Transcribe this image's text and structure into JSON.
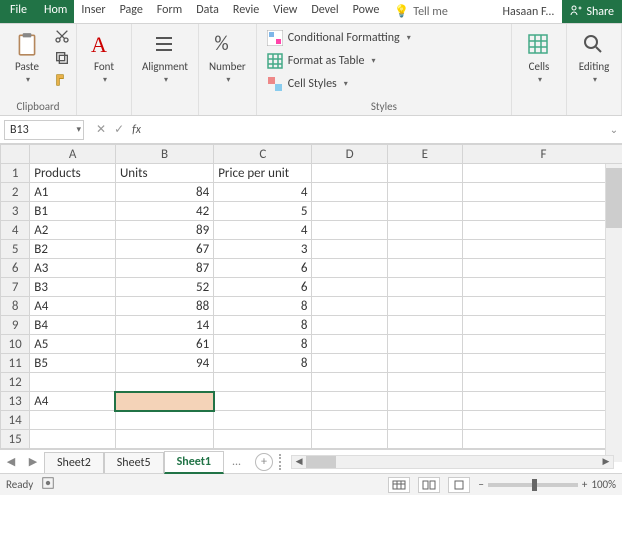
{
  "tabs": {
    "file": "File",
    "items": [
      "Hom",
      "Inser",
      "Page",
      "Form",
      "Data",
      "Revie",
      "View",
      "Devel",
      "Powe"
    ],
    "active_index": 0,
    "tellme": "Tell me",
    "user": "Hasaan F...",
    "share": "Share"
  },
  "ribbon": {
    "clipboard": {
      "label": "Clipboard",
      "paste": "Paste"
    },
    "font": {
      "label": "Font"
    },
    "alignment": {
      "label": "Alignment"
    },
    "number": {
      "label": "Number"
    },
    "styles": {
      "label": "Styles",
      "conditional": "Conditional Formatting",
      "table": "Format as Table",
      "cellstyles": "Cell Styles"
    },
    "cells": {
      "label": "Cells"
    },
    "editing": {
      "label": "Editing"
    }
  },
  "formula_bar": {
    "cellref": "B13",
    "formula": ""
  },
  "grid": {
    "columns": [
      "A",
      "B",
      "C",
      "D",
      "E",
      "F"
    ],
    "headers": {
      "A": "Products",
      "B": "Units",
      "C": "Price per unit"
    },
    "rows": [
      {
        "r": 2,
        "A": "A1",
        "B": 84,
        "C": 4
      },
      {
        "r": 3,
        "A": "B1",
        "B": 42,
        "C": 5
      },
      {
        "r": 4,
        "A": "A2",
        "B": 89,
        "C": 4
      },
      {
        "r": 5,
        "A": "B2",
        "B": 67,
        "C": 3
      },
      {
        "r": 6,
        "A": "A3",
        "B": 87,
        "C": 6
      },
      {
        "r": 7,
        "A": "B3",
        "B": 52,
        "C": 6
      },
      {
        "r": 8,
        "A": "A4",
        "B": 88,
        "C": 8
      },
      {
        "r": 9,
        "A": "B4",
        "B": 14,
        "C": 8
      },
      {
        "r": 10,
        "A": "A5",
        "B": 61,
        "C": 8
      },
      {
        "r": 11,
        "A": "B5",
        "B": 94,
        "C": 8
      }
    ],
    "row13_A": "A4",
    "selected_cell": "B13"
  },
  "sheet_tabs": {
    "tabs": [
      "Sheet2",
      "Sheet5",
      "Sheet1"
    ],
    "active_index": 2,
    "more": "..."
  },
  "status": {
    "ready": "Ready",
    "zoom": "100%"
  }
}
